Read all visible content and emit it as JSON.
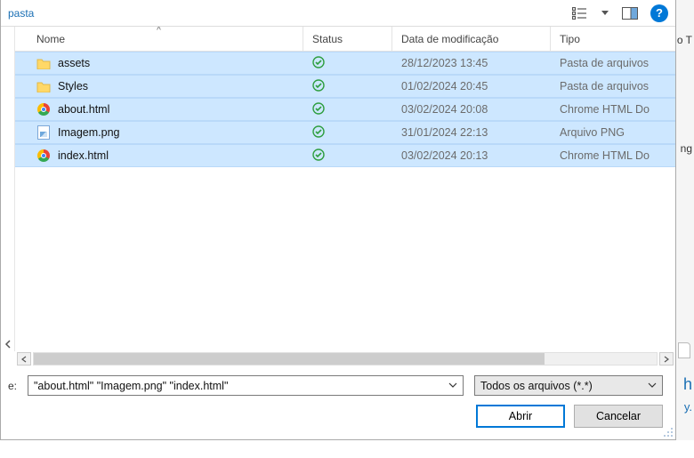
{
  "topbar": {
    "title_fragment": "pasta",
    "view_icon": "view-grid-icon",
    "dropdown_icon": "chevron-down-icon",
    "pane_icon": "preview-pane-icon",
    "help_icon": "help-icon",
    "help_glyph": "?"
  },
  "columns": {
    "nome": "Nome",
    "status": "Status",
    "data": "Data de modificação",
    "tipo": "Tipo",
    "sort_indicator": "^"
  },
  "rows": [
    {
      "icon": "folder",
      "name": "assets",
      "status": "synced",
      "date": "28/12/2023 13:45",
      "type": "Pasta de arquivos"
    },
    {
      "icon": "folder",
      "name": "Styles",
      "status": "synced",
      "date": "01/02/2024 20:45",
      "type": "Pasta de arquivos"
    },
    {
      "icon": "chrome",
      "name": "about.html",
      "status": "synced",
      "date": "03/02/2024 20:08",
      "type": "Chrome HTML Do"
    },
    {
      "icon": "png",
      "name": "Imagem.png",
      "status": "synced",
      "date": "31/01/2024 22:13",
      "type": "Arquivo PNG"
    },
    {
      "icon": "chrome",
      "name": "index.html",
      "status": "synced",
      "date": "03/02/2024 20:13",
      "type": "Chrome HTML Do"
    }
  ],
  "footer": {
    "name_label_fragment": "e:",
    "filename_value": "\"about.html\" \"Imagem.png\" \"index.html\"",
    "filter_value": "Todos os arquivos (*.*)",
    "open_label": "Abrir",
    "cancel_label": "Cancelar"
  },
  "behind": {
    "right_top_fragment": "o T",
    "right_mid_fragment": "ng",
    "right_bottom_fragment_1": "h",
    "right_bottom_fragment_2": "y.",
    "bottom_fragment": ""
  }
}
